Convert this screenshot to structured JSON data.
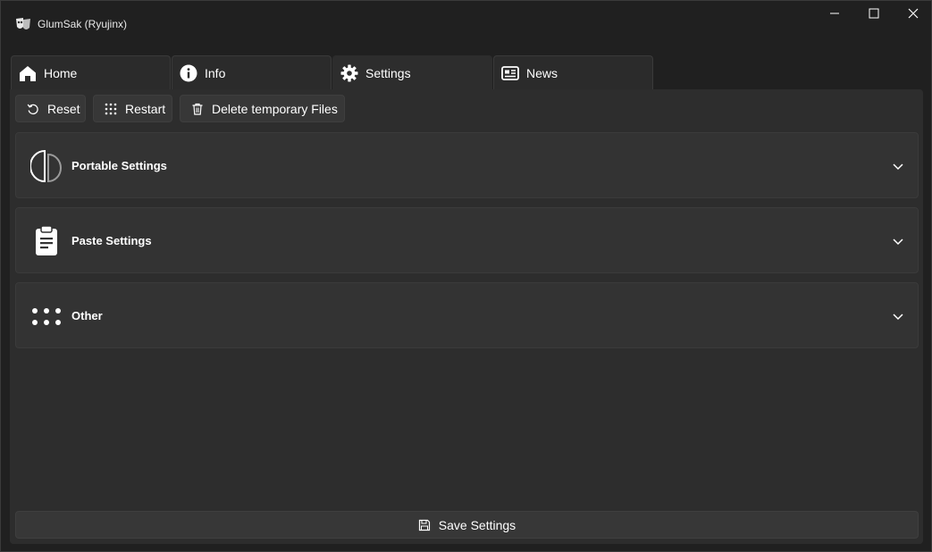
{
  "window": {
    "title": "GlumSak (Ryujinx)",
    "app_icon": "mask-icon",
    "controls": [
      "minimize-icon",
      "maximize-icon",
      "close-icon"
    ]
  },
  "tabs": [
    {
      "label": "Home",
      "icon": "home-icon",
      "active": false
    },
    {
      "label": "Info",
      "icon": "info-icon",
      "active": false
    },
    {
      "label": "Settings",
      "icon": "gear-icon",
      "active": true
    },
    {
      "label": "News",
      "icon": "news-icon",
      "active": false
    }
  ],
  "toolbar": {
    "reset_label": "Reset",
    "restart_label": "Restart",
    "delete_temp_label": "Delete temporary Files"
  },
  "sections": [
    {
      "title": "Portable Settings",
      "icon": "portable-icon",
      "expanded": false
    },
    {
      "title": "Paste Settings",
      "icon": "clipboard-icon",
      "expanded": false
    },
    {
      "title": "Other",
      "icon": "dots-icon",
      "expanded": false
    }
  ],
  "footer": {
    "save_label": "Save Settings"
  },
  "colors": {
    "background": "#202020",
    "panel": "#2d2d2d",
    "card": "#333333",
    "button": "#373737",
    "text": "#ffffff"
  }
}
